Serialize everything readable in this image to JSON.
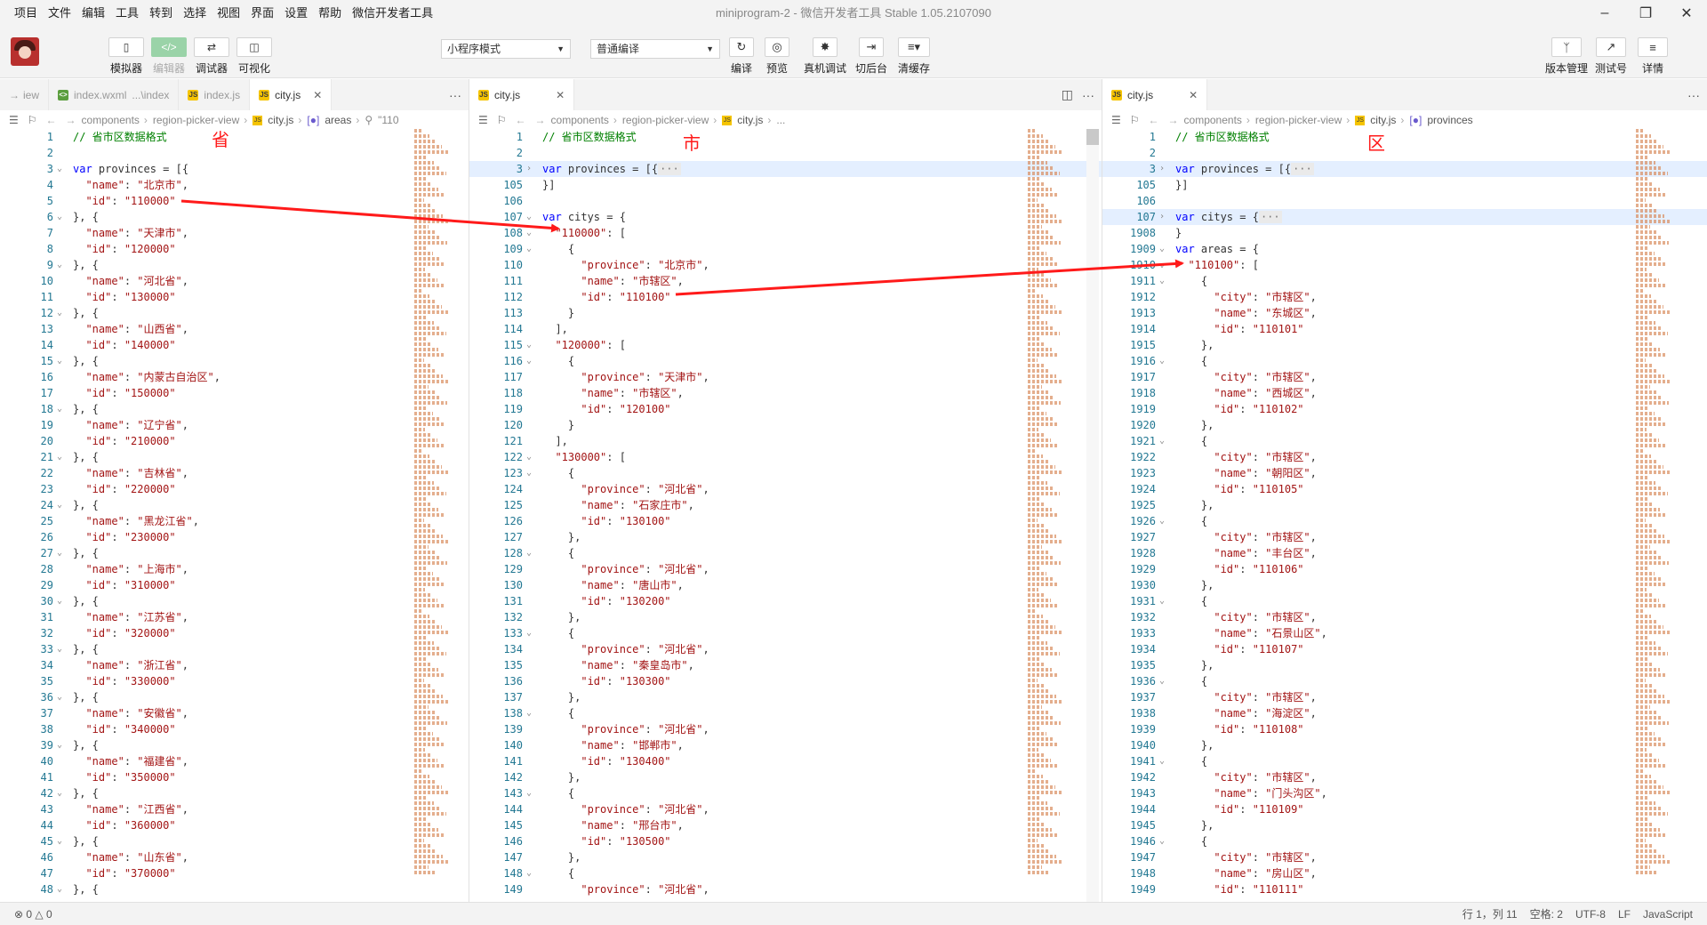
{
  "menubar": {
    "items": [
      "项目",
      "文件",
      "编辑",
      "工具",
      "转到",
      "选择",
      "视图",
      "界面",
      "设置",
      "帮助",
      "微信开发者工具"
    ],
    "title": "miniprogram-2 - 微信开发者工具 Stable 1.05.2107090"
  },
  "toolbar": {
    "left": [
      {
        "label": "模拟器",
        "icon": "phone-icon"
      },
      {
        "label": "编辑器",
        "icon": "code-icon"
      },
      {
        "label": "调试器",
        "icon": "debug-icon"
      },
      {
        "label": "可视化",
        "icon": "layout-icon"
      }
    ],
    "mode_select": "小程序模式",
    "compile_select": "普通编译",
    "center": [
      {
        "label": "编译",
        "icon": "refresh-icon"
      },
      {
        "label": "预览",
        "icon": "eye-icon"
      },
      {
        "label": "真机调试",
        "icon": "bug-icon"
      },
      {
        "label": "切后台",
        "icon": "switch-icon"
      },
      {
        "label": "清缓存",
        "icon": "layers-icon"
      }
    ],
    "right": [
      {
        "label": "版本管理",
        "icon": "branch-icon"
      },
      {
        "label": "测试号",
        "icon": "external-icon"
      },
      {
        "label": "详情",
        "icon": "menu-icon"
      }
    ]
  },
  "pane1": {
    "tabs": [
      "iew",
      "index.wxml",
      "...\\index",
      "index.js",
      "city.js"
    ],
    "breadcrumb": [
      "components",
      "region-picker-view",
      "city.js",
      "areas",
      "\"110"
    ],
    "annotation": "省",
    "lines": [
      {
        "n": "1",
        "t": "// 省市区数据格式"
      },
      {
        "n": "2",
        "t": ""
      },
      {
        "n": "3",
        "t": "var provinces = [{"
      },
      {
        "n": "4",
        "t": "  \"name\": \"北京市\","
      },
      {
        "n": "5",
        "t": "  \"id\": \"110000\""
      },
      {
        "n": "6",
        "t": "}, {"
      },
      {
        "n": "7",
        "t": "  \"name\": \"天津市\","
      },
      {
        "n": "8",
        "t": "  \"id\": \"120000\""
      },
      {
        "n": "9",
        "t": "}, {"
      },
      {
        "n": "10",
        "t": "  \"name\": \"河北省\","
      },
      {
        "n": "11",
        "t": "  \"id\": \"130000\""
      },
      {
        "n": "12",
        "t": "}, {"
      },
      {
        "n": "13",
        "t": "  \"name\": \"山西省\","
      },
      {
        "n": "14",
        "t": "  \"id\": \"140000\""
      },
      {
        "n": "15",
        "t": "}, {"
      },
      {
        "n": "16",
        "t": "  \"name\": \"内蒙古自治区\","
      },
      {
        "n": "17",
        "t": "  \"id\": \"150000\""
      },
      {
        "n": "18",
        "t": "}, {"
      },
      {
        "n": "19",
        "t": "  \"name\": \"辽宁省\","
      },
      {
        "n": "20",
        "t": "  \"id\": \"210000\""
      },
      {
        "n": "21",
        "t": "}, {"
      },
      {
        "n": "22",
        "t": "  \"name\": \"吉林省\","
      },
      {
        "n": "23",
        "t": "  \"id\": \"220000\""
      },
      {
        "n": "24",
        "t": "}, {"
      },
      {
        "n": "25",
        "t": "  \"name\": \"黑龙江省\","
      },
      {
        "n": "26",
        "t": "  \"id\": \"230000\""
      },
      {
        "n": "27",
        "t": "}, {"
      },
      {
        "n": "28",
        "t": "  \"name\": \"上海市\","
      },
      {
        "n": "29",
        "t": "  \"id\": \"310000\""
      },
      {
        "n": "30",
        "t": "}, {"
      },
      {
        "n": "31",
        "t": "  \"name\": \"江苏省\","
      },
      {
        "n": "32",
        "t": "  \"id\": \"320000\""
      },
      {
        "n": "33",
        "t": "}, {"
      },
      {
        "n": "34",
        "t": "  \"name\": \"浙江省\","
      },
      {
        "n": "35",
        "t": "  \"id\": \"330000\""
      },
      {
        "n": "36",
        "t": "}, {"
      },
      {
        "n": "37",
        "t": "  \"name\": \"安徽省\","
      },
      {
        "n": "38",
        "t": "  \"id\": \"340000\""
      },
      {
        "n": "39",
        "t": "}, {"
      },
      {
        "n": "40",
        "t": "  \"name\": \"福建省\","
      },
      {
        "n": "41",
        "t": "  \"id\": \"350000\""
      },
      {
        "n": "42",
        "t": "}, {"
      },
      {
        "n": "43",
        "t": "  \"name\": \"江西省\","
      },
      {
        "n": "44",
        "t": "  \"id\": \"360000\""
      },
      {
        "n": "45",
        "t": "}, {"
      },
      {
        "n": "46",
        "t": "  \"name\": \"山东省\","
      },
      {
        "n": "47",
        "t": "  \"id\": \"370000\""
      },
      {
        "n": "48",
        "t": "}, {"
      }
    ]
  },
  "pane2": {
    "tabs": [
      "city.js"
    ],
    "breadcrumb": [
      "components",
      "region-picker-view",
      "city.js",
      "..."
    ],
    "annotation": "市",
    "lines": [
      {
        "n": "1",
        "t": "// 省市区数据格式"
      },
      {
        "n": "2",
        "t": ""
      },
      {
        "n": "3",
        "t": "var provinces = [{···"
      },
      {
        "n": "105",
        "t": "}]"
      },
      {
        "n": "106",
        "t": ""
      },
      {
        "n": "107",
        "t": "var citys = {"
      },
      {
        "n": "108",
        "t": "  \"110000\": ["
      },
      {
        "n": "109",
        "t": "    {"
      },
      {
        "n": "110",
        "t": "      \"province\": \"北京市\","
      },
      {
        "n": "111",
        "t": "      \"name\": \"市辖区\","
      },
      {
        "n": "112",
        "t": "      \"id\": \"110100\""
      },
      {
        "n": "113",
        "t": "    }"
      },
      {
        "n": "114",
        "t": "  ],"
      },
      {
        "n": "115",
        "t": "  \"120000\": ["
      },
      {
        "n": "116",
        "t": "    {"
      },
      {
        "n": "117",
        "t": "      \"province\": \"天津市\","
      },
      {
        "n": "118",
        "t": "      \"name\": \"市辖区\","
      },
      {
        "n": "119",
        "t": "      \"id\": \"120100\""
      },
      {
        "n": "120",
        "t": "    }"
      },
      {
        "n": "121",
        "t": "  ],"
      },
      {
        "n": "122",
        "t": "  \"130000\": ["
      },
      {
        "n": "123",
        "t": "    {"
      },
      {
        "n": "124",
        "t": "      \"province\": \"河北省\","
      },
      {
        "n": "125",
        "t": "      \"name\": \"石家庄市\","
      },
      {
        "n": "126",
        "t": "      \"id\": \"130100\""
      },
      {
        "n": "127",
        "t": "    },"
      },
      {
        "n": "128",
        "t": "    {"
      },
      {
        "n": "129",
        "t": "      \"province\": \"河北省\","
      },
      {
        "n": "130",
        "t": "      \"name\": \"唐山市\","
      },
      {
        "n": "131",
        "t": "      \"id\": \"130200\""
      },
      {
        "n": "132",
        "t": "    },"
      },
      {
        "n": "133",
        "t": "    {"
      },
      {
        "n": "134",
        "t": "      \"province\": \"河北省\","
      },
      {
        "n": "135",
        "t": "      \"name\": \"秦皇岛市\","
      },
      {
        "n": "136",
        "t": "      \"id\": \"130300\""
      },
      {
        "n": "137",
        "t": "    },"
      },
      {
        "n": "138",
        "t": "    {"
      },
      {
        "n": "139",
        "t": "      \"province\": \"河北省\","
      },
      {
        "n": "140",
        "t": "      \"name\": \"邯郸市\","
      },
      {
        "n": "141",
        "t": "      \"id\": \"130400\""
      },
      {
        "n": "142",
        "t": "    },"
      },
      {
        "n": "143",
        "t": "    {"
      },
      {
        "n": "144",
        "t": "      \"province\": \"河北省\","
      },
      {
        "n": "145",
        "t": "      \"name\": \"邢台市\","
      },
      {
        "n": "146",
        "t": "      \"id\": \"130500\""
      },
      {
        "n": "147",
        "t": "    },"
      },
      {
        "n": "148",
        "t": "    {"
      },
      {
        "n": "149",
        "t": "      \"province\": \"河北省\","
      }
    ]
  },
  "pane3": {
    "tabs": [
      "city.js"
    ],
    "breadcrumb": [
      "components",
      "region-picker-view",
      "city.js",
      "provinces"
    ],
    "annotation": "区",
    "lines": [
      {
        "n": "1",
        "t": "// 省市区数据格式"
      },
      {
        "n": "2",
        "t": ""
      },
      {
        "n": "3",
        "t": "var provinces = [{···"
      },
      {
        "n": "105",
        "t": "}]"
      },
      {
        "n": "106",
        "t": ""
      },
      {
        "n": "107",
        "t": "var citys = {···"
      },
      {
        "n": "1908",
        "t": "}"
      },
      {
        "n": "1909",
        "t": "var areas = {"
      },
      {
        "n": "1910",
        "t": "  \"110100\": ["
      },
      {
        "n": "1911",
        "t": "    {"
      },
      {
        "n": "1912",
        "t": "      \"city\": \"市辖区\","
      },
      {
        "n": "1913",
        "t": "      \"name\": \"东城区\","
      },
      {
        "n": "1914",
        "t": "      \"id\": \"110101\""
      },
      {
        "n": "1915",
        "t": "    },"
      },
      {
        "n": "1916",
        "t": "    {"
      },
      {
        "n": "1917",
        "t": "      \"city\": \"市辖区\","
      },
      {
        "n": "1918",
        "t": "      \"name\": \"西城区\","
      },
      {
        "n": "1919",
        "t": "      \"id\": \"110102\""
      },
      {
        "n": "1920",
        "t": "    },"
      },
      {
        "n": "1921",
        "t": "    {"
      },
      {
        "n": "1922",
        "t": "      \"city\": \"市辖区\","
      },
      {
        "n": "1923",
        "t": "      \"name\": \"朝阳区\","
      },
      {
        "n": "1924",
        "t": "      \"id\": \"110105\""
      },
      {
        "n": "1925",
        "t": "    },"
      },
      {
        "n": "1926",
        "t": "    {"
      },
      {
        "n": "1927",
        "t": "      \"city\": \"市辖区\","
      },
      {
        "n": "1928",
        "t": "      \"name\": \"丰台区\","
      },
      {
        "n": "1929",
        "t": "      \"id\": \"110106\""
      },
      {
        "n": "1930",
        "t": "    },"
      },
      {
        "n": "1931",
        "t": "    {"
      },
      {
        "n": "1932",
        "t": "      \"city\": \"市辖区\","
      },
      {
        "n": "1933",
        "t": "      \"name\": \"石景山区\","
      },
      {
        "n": "1934",
        "t": "      \"id\": \"110107\""
      },
      {
        "n": "1935",
        "t": "    },"
      },
      {
        "n": "1936",
        "t": "    {"
      },
      {
        "n": "1937",
        "t": "      \"city\": \"市辖区\","
      },
      {
        "n": "1938",
        "t": "      \"name\": \"海淀区\","
      },
      {
        "n": "1939",
        "t": "      \"id\": \"110108\""
      },
      {
        "n": "1940",
        "t": "    },"
      },
      {
        "n": "1941",
        "t": "    {"
      },
      {
        "n": "1942",
        "t": "      \"city\": \"市辖区\","
      },
      {
        "n": "1943",
        "t": "      \"name\": \"门头沟区\","
      },
      {
        "n": "1944",
        "t": "      \"id\": \"110109\""
      },
      {
        "n": "1945",
        "t": "    },"
      },
      {
        "n": "1946",
        "t": "    {"
      },
      {
        "n": "1947",
        "t": "      \"city\": \"市辖区\","
      },
      {
        "n": "1948",
        "t": "      \"name\": \"房山区\","
      },
      {
        "n": "1949",
        "t": "      \"id\": \"110111\""
      }
    ]
  },
  "statusbar": {
    "left": "⊗ 0 △ 0",
    "position": "行 1，列 11",
    "spaces": "空格: 2",
    "encoding": "UTF-8",
    "eol": "LF",
    "language": "JavaScript"
  },
  "colors": {
    "comment": "#008000",
    "keyword": "#0000ff",
    "string": "#a31515",
    "line_number": "#237893",
    "annotation": "#ff1a1a",
    "active_button": "#9ad3a8"
  }
}
